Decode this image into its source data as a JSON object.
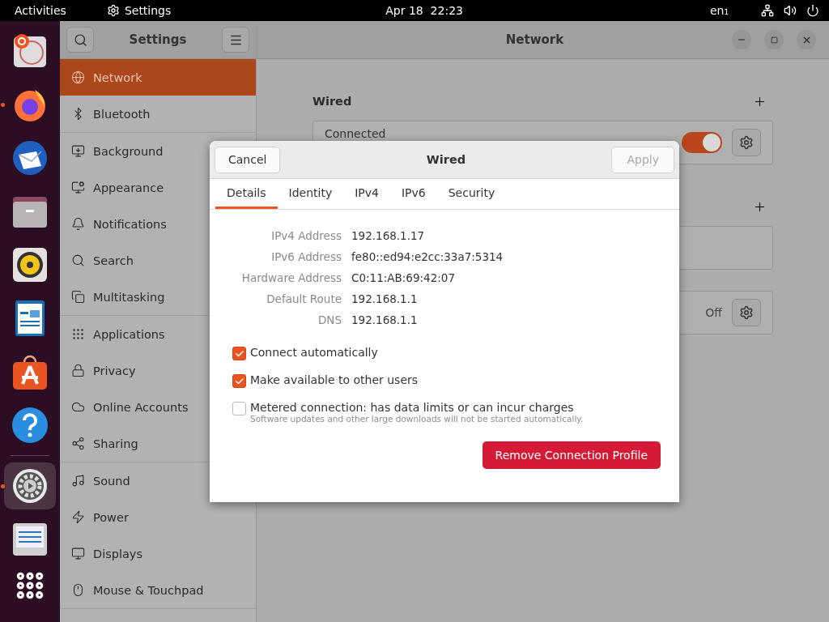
{
  "top_bar": {
    "activities": "Activities",
    "app": "Settings",
    "clock": "Apr 18  22:23",
    "input_source": "en₁"
  },
  "dock": {
    "apps": [
      {
        "running": false,
        "focused": false
      },
      {
        "running": true,
        "focused": false
      },
      {
        "running": false,
        "focused": false
      },
      {
        "running": false,
        "focused": false
      },
      {
        "running": false,
        "focused": false
      },
      {
        "running": false,
        "focused": false
      },
      {
        "running": false,
        "focused": false
      },
      {
        "running": false,
        "focused": false
      },
      {
        "running": true,
        "focused": true
      },
      {
        "running": false,
        "focused": false
      }
    ]
  },
  "sidebar": {
    "title": "Settings",
    "groups": [
      {
        "items": [
          {
            "label": "Network",
            "selected": true
          },
          {
            "label": "Bluetooth",
            "selected": false
          }
        ]
      },
      {
        "items": [
          {
            "label": "Background",
            "selected": false
          },
          {
            "label": "Appearance",
            "selected": false
          },
          {
            "label": "Notifications",
            "selected": false
          },
          {
            "label": "Search",
            "selected": false
          },
          {
            "label": "Multitasking",
            "selected": false
          }
        ]
      },
      {
        "items": [
          {
            "label": "Applications",
            "selected": false
          },
          {
            "label": "Privacy",
            "selected": false
          },
          {
            "label": "Online Accounts",
            "selected": false
          },
          {
            "label": "Sharing",
            "selected": false
          }
        ]
      },
      {
        "items": [
          {
            "label": "Sound",
            "selected": false
          },
          {
            "label": "Power",
            "selected": false
          },
          {
            "label": "Displays",
            "selected": false
          },
          {
            "label": "Mouse & Touchpad",
            "selected": false
          }
        ]
      }
    ]
  },
  "panel": {
    "title": "Network",
    "sections": [
      {
        "kind": "wired",
        "title": "Wired",
        "status": "Connected",
        "on": true
      },
      {
        "kind": "empty"
      },
      {
        "kind": "proxy",
        "status": "Off"
      }
    ]
  },
  "dialog": {
    "title": "Wired",
    "cancel": "Cancel",
    "apply": "Apply",
    "apply_disabled": true,
    "tabs": [
      {
        "label": "Details",
        "selected": true
      },
      {
        "label": "Identity",
        "selected": false
      },
      {
        "label": "IPv4",
        "selected": false
      },
      {
        "label": "IPv6",
        "selected": false
      },
      {
        "label": "Security",
        "selected": false
      }
    ],
    "details": [
      {
        "label": "IPv4 Address",
        "value": "192.168.1.17"
      },
      {
        "label": "IPv6 Address",
        "value": "fe80::ed94:e2cc:33a7:5314"
      },
      {
        "label": "Hardware Address",
        "value": "C0:11:AB:69:42:07"
      },
      {
        "label": "Default Route",
        "value": "192.168.1.1"
      },
      {
        "label": "DNS",
        "value": "192.168.1.1"
      }
    ],
    "options": [
      {
        "label": "Connect automatically",
        "checked": true
      },
      {
        "label": "Make available to other users",
        "checked": true
      },
      {
        "label": "Metered connection: has data limits or can incur charges",
        "hint": "Software updates and other large downloads will not be started automatically.",
        "checked": false
      }
    ],
    "remove": "Remove Connection Profile"
  }
}
